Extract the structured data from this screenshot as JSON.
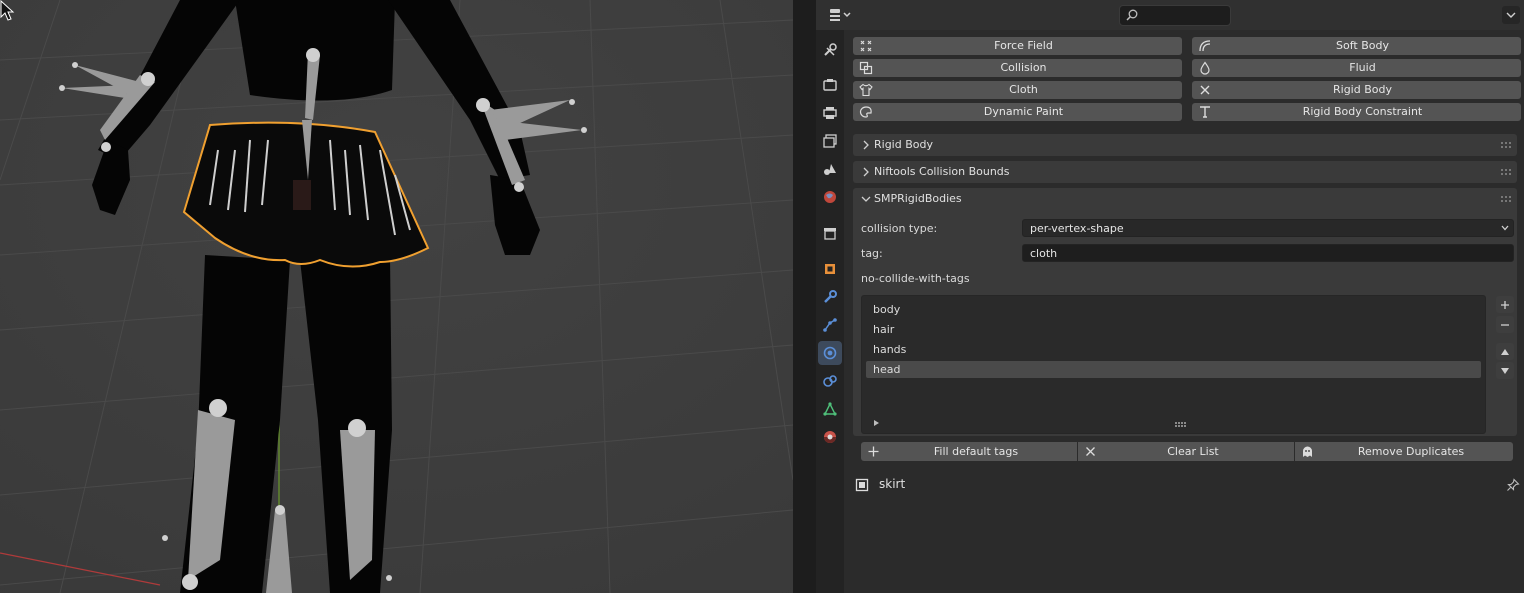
{
  "header": {
    "editor_type_icon": "properties-editor-icon",
    "search": {
      "placeholder": "",
      "value": ""
    }
  },
  "tabs": [
    {
      "name": "tool-tab",
      "icon": "wrench-screwdriver-icon"
    },
    {
      "name": "render-tab",
      "icon": "camera-icon"
    },
    {
      "name": "output-tab",
      "icon": "printer-icon"
    },
    {
      "name": "view-layer-tab",
      "icon": "image-stack-icon"
    },
    {
      "name": "scene-tab",
      "icon": "scene-icon"
    },
    {
      "name": "world-tab",
      "icon": "globe-icon"
    },
    {
      "name": "collection-tab",
      "icon": "box-icon"
    },
    {
      "name": "object-tab",
      "icon": "square-icon"
    },
    {
      "name": "modifiers-tab",
      "icon": "wrench-icon"
    },
    {
      "name": "particles-tab",
      "icon": "particles-icon"
    },
    {
      "name": "physics-tab",
      "icon": "orbit-icon",
      "active": true
    },
    {
      "name": "constraints-tab",
      "icon": "constraint-icon"
    },
    {
      "name": "data-tab",
      "icon": "mesh-triangle-icon"
    },
    {
      "name": "material-tab",
      "icon": "material-sphere-icon"
    }
  ],
  "physics_buttons": {
    "force_field": "Force Field",
    "soft_body": "Soft Body",
    "collision": "Collision",
    "fluid": "Fluid",
    "cloth": "Cloth",
    "rigid_body": "Rigid Body",
    "dynamic_paint": "Dynamic Paint",
    "rigid_body_constraint": "Rigid Body Constraint"
  },
  "panels": {
    "rigid_body": "Rigid Body",
    "niftools": "Niftools Collision Bounds",
    "smp": "SMPRigidBodies"
  },
  "smp": {
    "collision_type_label": "collision type:",
    "collision_type_value": "per-vertex-shape",
    "tag_label": "tag:",
    "tag_value": "cloth",
    "no_collide_label": "no-collide-with-tags",
    "tags": [
      "body",
      "hair",
      "hands",
      "head"
    ],
    "selected_tag": "head",
    "fill_default": "Fill default tags",
    "clear_list": "Clear List",
    "remove_duplicates": "Remove Duplicates"
  },
  "context": {
    "object_name": "skirt"
  }
}
